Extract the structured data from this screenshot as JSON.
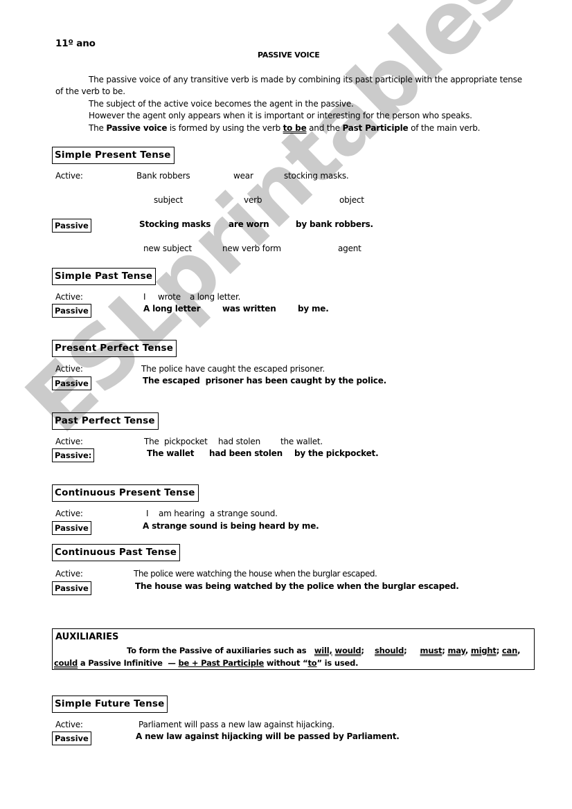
{
  "document": {
    "grade": "11º ano",
    "title": "PASSIVE VOICE",
    "intro": {
      "p1_line1": "The passive voice of any transitive verb is made by combining its past participle with the appropriate tense",
      "p1_line2": "of the verb to be.",
      "p2": "The subject of the active voice becomes the agent in the passive.",
      "p3": "However the agent only appears when it is important or interesting for the person who speaks.",
      "p4": {
        "t1": "The ",
        "b1": "Passive voice",
        "t2": " is formed by using the verb ",
        "u1": "to be",
        "t3": " and the ",
        "b2": "Past Participle",
        "t4": " of the main verb."
      }
    },
    "active_label": "Active:",
    "passive_label": "Passive",
    "passive_label_colon": "Passive:",
    "sections": [
      {
        "heading": "Simple Present Tense",
        "active_parts": [
          "Bank robbers",
          "wear",
          "stocking masks."
        ],
        "active_roles": [
          "subject",
          "verb",
          "object"
        ],
        "passive_parts": [
          "Stocking masks",
          "are worn",
          "by bank robbers."
        ],
        "passive_roles": [
          "new subject",
          "new verb form",
          "agent"
        ]
      },
      {
        "heading": "Simple Past Tense",
        "active_parts": [
          "I",
          "wrote",
          "a long letter."
        ],
        "passive_parts": [
          "A long letter",
          "was written",
          "by me."
        ]
      },
      {
        "heading": "Present Perfect Tense",
        "active": "The police have caught the escaped prisoner.",
        "passive": "The escaped  prisoner has been caught by the police."
      },
      {
        "heading": "Past Perfect Tense",
        "active_parts": [
          "The  pickpocket",
          "had stolen",
          "the wallet."
        ],
        "passive_parts": [
          "The wallet",
          "had been stolen",
          "by the pickpocket."
        ]
      },
      {
        "heading": "Continuous Present Tense",
        "active_parts": [
          "I",
          "am hearing  a strange sound."
        ],
        "passive": "A strange sound is being heard by me."
      },
      {
        "heading": "Continuous Past Tense",
        "active": "The police were watching the house when the burglar escaped.",
        "passive": "The house was being watched by the police when the burglar escaped."
      },
      {
        "heading": "Simple Future Tense",
        "active": "Parliament will pass a new law against hijacking.",
        "passive": "A new law against hijacking will be passed by Parliament."
      }
    ],
    "auxiliaries": {
      "heading": "AUXILIARIES",
      "line1_text": "To form the Passive of auxiliaries such as",
      "modals": [
        "will,",
        "would",
        "should",
        "must",
        "may",
        "might",
        "can",
        "could"
      ],
      "line2_text1": " a Passive Infinitive  — ",
      "line2_u": "be + Past Participle",
      "line2_text2": " without “",
      "line2_to": "to",
      "line2_text3": "” is used."
    },
    "watermark": "ESLprintables.com"
  }
}
